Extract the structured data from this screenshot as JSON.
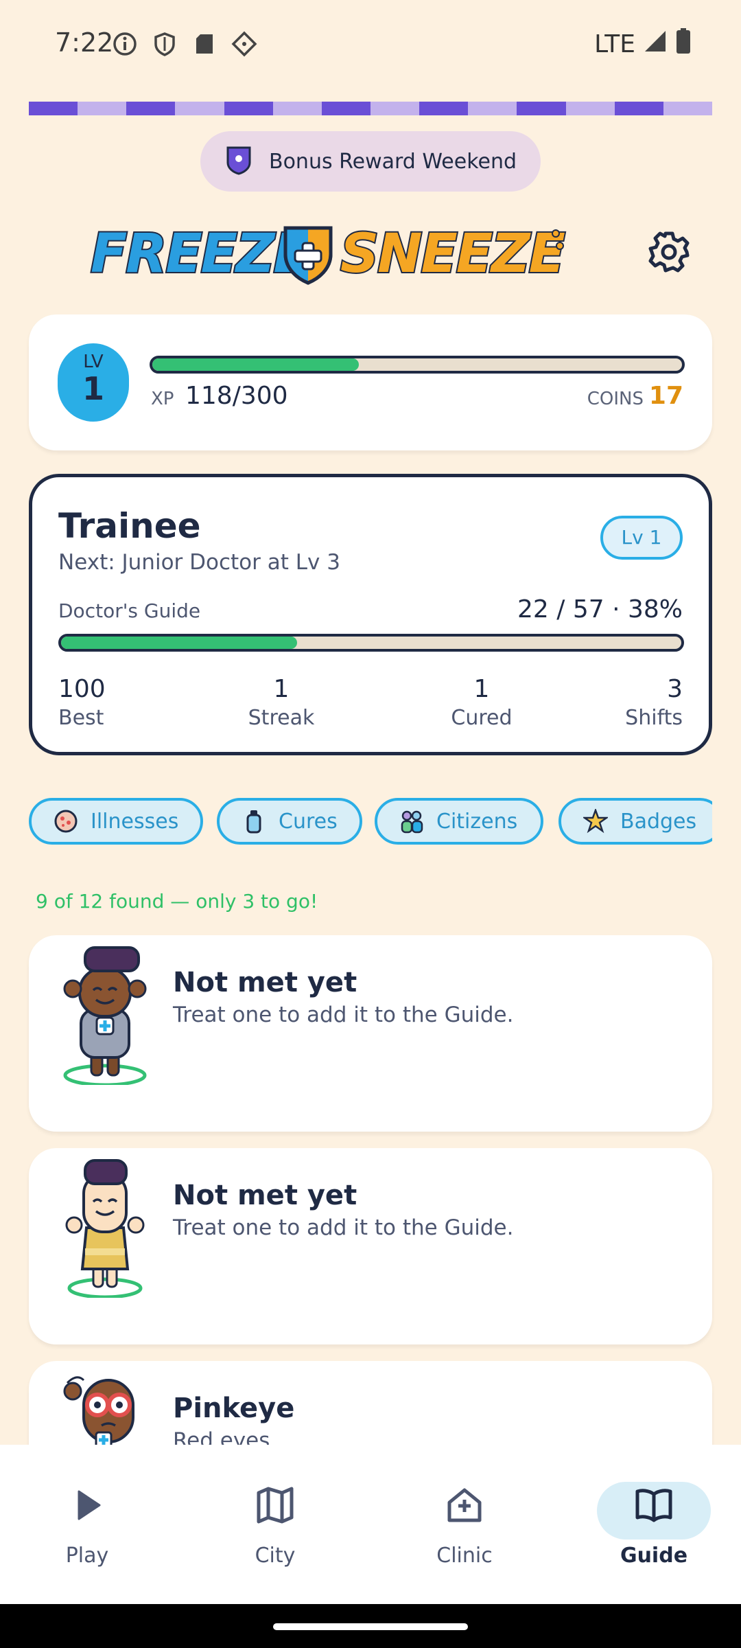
{
  "status_bar": {
    "time": "7:22",
    "network": "LTE",
    "icons": [
      "info-icon",
      "shield-icon",
      "sd-card-icon",
      "diamond-icon",
      "signal-icon",
      "battery-icon"
    ]
  },
  "banner": {
    "label": "Bonus Reward Weekend",
    "icon": "shield-icon"
  },
  "logo": {
    "text_left": "FREEZE",
    "text_right": "SNEEZE",
    "colors": {
      "left": "#2a9ee0",
      "right": "#f5a623"
    }
  },
  "level": {
    "lv_label": "LV",
    "lv_value": "1",
    "xp_label": "XP",
    "xp_value": "118/300",
    "xp_fraction": 0.39,
    "coins_label": "COINS",
    "coins_value": "17"
  },
  "rank": {
    "title": "Trainee",
    "next": "Next: Junior Doctor at Lv 3",
    "pill": "Lv 1",
    "guide_label": "Doctor's Guide",
    "guide_value": "22 / 57 · 38%",
    "guide_fraction": 0.38,
    "stats": [
      {
        "num": "100",
        "label": "Best"
      },
      {
        "num": "1",
        "label": "Streak"
      },
      {
        "num": "1",
        "label": "Cured"
      },
      {
        "num": "3",
        "label": "Shifts"
      }
    ]
  },
  "tabs": [
    {
      "label": "Illnesses",
      "icon": "germ-icon"
    },
    {
      "label": "Cures",
      "icon": "bottle-icon"
    },
    {
      "label": "Citizens",
      "icon": "people-icon"
    },
    {
      "label": "Badges",
      "icon": "star-badge-icon"
    }
  ],
  "found_text": "9 of 12 found — only 3 to go!",
  "cards": [
    {
      "title": "Not met yet",
      "sub": "Treat one to add it to the Guide."
    },
    {
      "title": "Not met yet",
      "sub": "Treat one to add it to the Guide."
    },
    {
      "title": "Pinkeye",
      "sub": "Red eyes"
    }
  ],
  "nav": [
    {
      "label": "Play",
      "icon": "play-icon"
    },
    {
      "label": "City",
      "icon": "map-icon"
    },
    {
      "label": "Clinic",
      "icon": "clinic-icon"
    },
    {
      "label": "Guide",
      "icon": "book-icon",
      "active": true
    }
  ],
  "colors": {
    "accent": "#2aaee6",
    "progress": "#34c074",
    "stripe_dark": "#6a4fd6",
    "stripe_light": "#c3b2ec",
    "background": "#fdf1e0"
  }
}
